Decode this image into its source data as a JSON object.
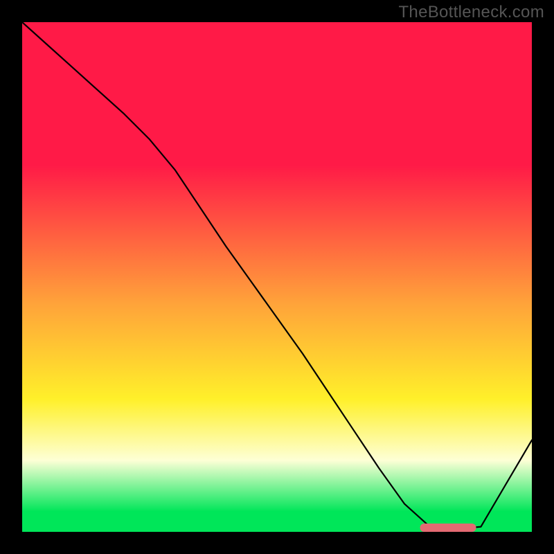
{
  "watermark": "TheBottleneck.com",
  "colors": {
    "red": "#ff1a47",
    "orange": "#ffa23a",
    "yellow": "#fff02a",
    "pale": "#fdffd6",
    "green": "#00e659",
    "marker": "#e46a72",
    "curve": "#000000"
  },
  "chart_data": {
    "type": "line",
    "title": "",
    "xlabel": "",
    "ylabel": "",
    "xlim": [
      0,
      100
    ],
    "ylim": [
      0,
      100
    ],
    "x": [
      0,
      5,
      10,
      15,
      20,
      25,
      30,
      35,
      40,
      45,
      50,
      55,
      60,
      65,
      70,
      75,
      80,
      85,
      90,
      95,
      100
    ],
    "y": [
      100,
      95.5,
      91,
      86.5,
      82,
      77,
      71,
      63.5,
      56,
      49,
      42,
      35,
      27.5,
      20,
      12.5,
      5.5,
      1,
      0.5,
      1,
      9.5,
      18
    ],
    "marker": {
      "x_min": 78,
      "x_max": 89,
      "y": 0.8
    },
    "gradient_stops": [
      {
        "pos": 0.0,
        "color_key": "red"
      },
      {
        "pos": 0.28,
        "color_key": "red"
      },
      {
        "pos": 0.55,
        "color_key": "orange"
      },
      {
        "pos": 0.74,
        "color_key": "yellow"
      },
      {
        "pos": 0.86,
        "color_key": "pale"
      },
      {
        "pos": 0.96,
        "color_key": "green"
      },
      {
        "pos": 1.0,
        "color_key": "green"
      }
    ]
  }
}
